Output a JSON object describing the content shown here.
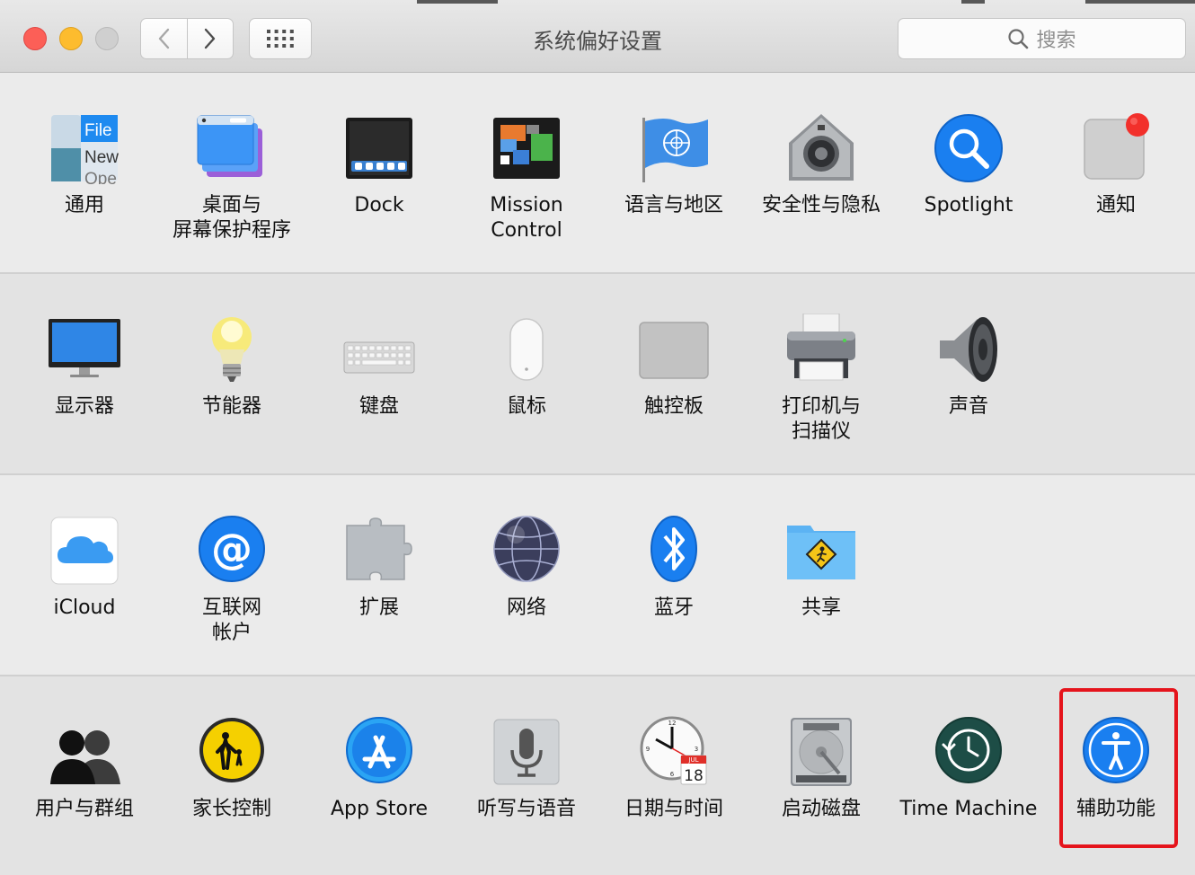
{
  "window": {
    "title": "系统偏好设置"
  },
  "toolbar": {
    "search_placeholder": "搜索"
  },
  "sections": [
    {
      "items": [
        {
          "label": "通用",
          "icon": "general-icon"
        },
        {
          "label": "桌面与\n屏幕保护程序",
          "icon": "desktop-screensaver-icon"
        },
        {
          "label": "Dock",
          "icon": "dock-icon"
        },
        {
          "label": "Mission\nControl",
          "icon": "mission-control-icon"
        },
        {
          "label": "语言与地区",
          "icon": "language-region-icon"
        },
        {
          "label": "安全性与隐私",
          "icon": "security-privacy-icon"
        },
        {
          "label": "Spotlight",
          "icon": "spotlight-icon"
        },
        {
          "label": "通知",
          "icon": "notifications-icon"
        }
      ]
    },
    {
      "items": [
        {
          "label": "显示器",
          "icon": "displays-icon"
        },
        {
          "label": "节能器",
          "icon": "energy-saver-icon"
        },
        {
          "label": "键盘",
          "icon": "keyboard-icon"
        },
        {
          "label": "鼠标",
          "icon": "mouse-icon"
        },
        {
          "label": "触控板",
          "icon": "trackpad-icon"
        },
        {
          "label": "打印机与\n扫描仪",
          "icon": "printers-scanners-icon"
        },
        {
          "label": "声音",
          "icon": "sound-icon"
        }
      ]
    },
    {
      "items": [
        {
          "label": "iCloud",
          "icon": "icloud-icon"
        },
        {
          "label": "互联网\n帐户",
          "icon": "internet-accounts-icon"
        },
        {
          "label": "扩展",
          "icon": "extensions-icon"
        },
        {
          "label": "网络",
          "icon": "network-icon"
        },
        {
          "label": "蓝牙",
          "icon": "bluetooth-icon"
        },
        {
          "label": "共享",
          "icon": "sharing-icon"
        }
      ]
    },
    {
      "items": [
        {
          "label": "用户与群组",
          "icon": "users-groups-icon"
        },
        {
          "label": "家长控制",
          "icon": "parental-controls-icon"
        },
        {
          "label": "App Store",
          "icon": "app-store-icon"
        },
        {
          "label": "听写与语音",
          "icon": "dictation-speech-icon"
        },
        {
          "label": "日期与时间",
          "icon": "date-time-icon"
        },
        {
          "label": "启动磁盘",
          "icon": "startup-disk-icon"
        },
        {
          "label": "Time Machine",
          "icon": "time-machine-icon"
        },
        {
          "label": "辅助功能",
          "icon": "accessibility-icon"
        }
      ]
    }
  ],
  "icon_text": {
    "general_file": "File",
    "general_new": "New",
    "general_open": "Ope",
    "calendar_month": "JUL",
    "calendar_day": "18"
  },
  "colors": {
    "highlight": "#e5141c",
    "accent_blue": "#1a7ff0"
  }
}
